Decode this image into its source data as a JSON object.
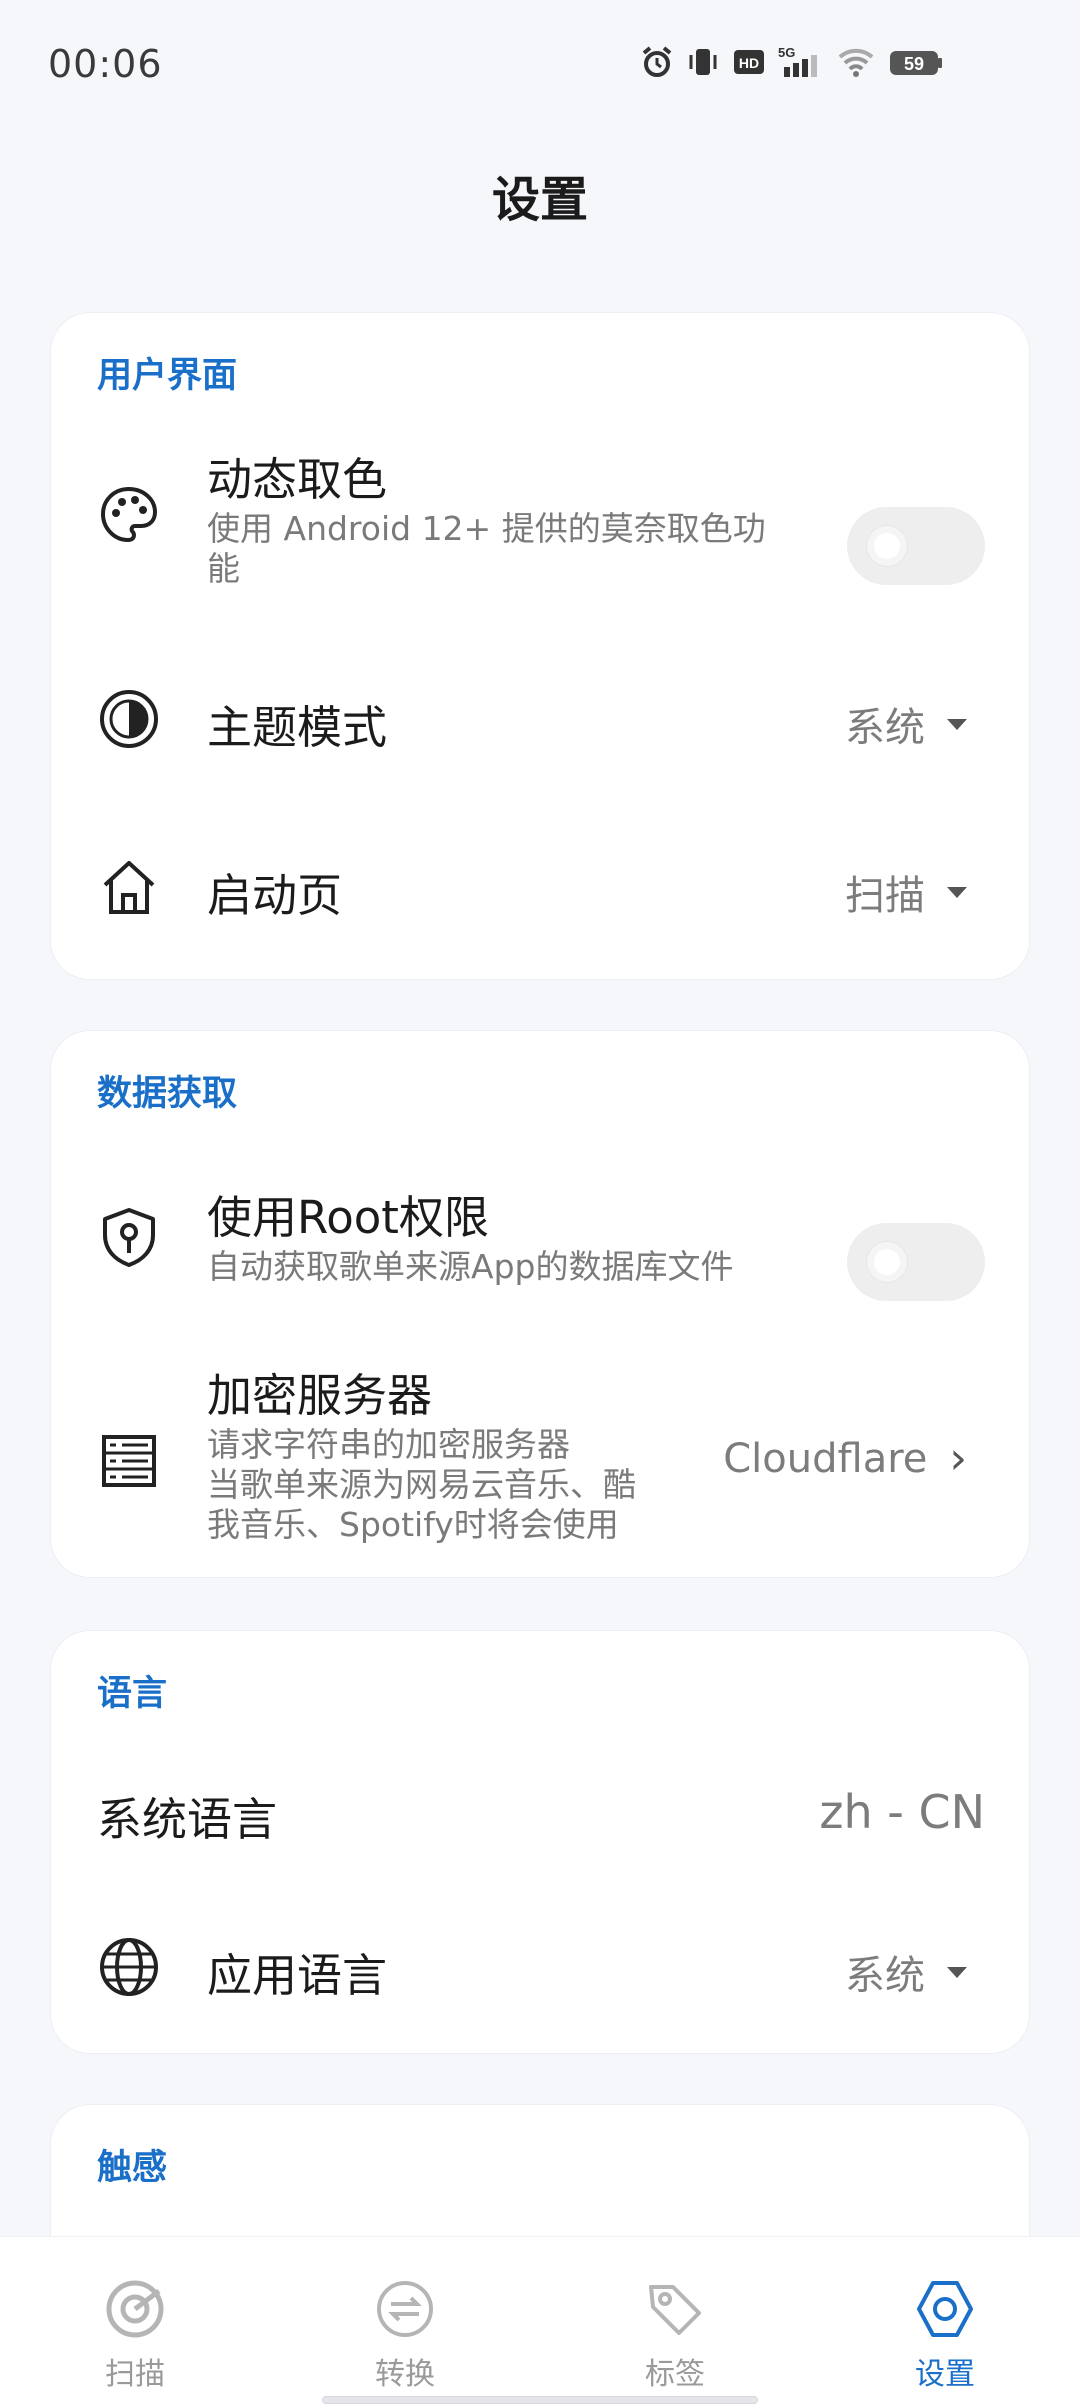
{
  "status_bar": {
    "time": "00:06",
    "network": "5G",
    "hd": "HD",
    "battery": "59",
    "icons": [
      "alarm-icon",
      "vibrate-icon",
      "hd-icon",
      "signal-icon",
      "wifi-icon",
      "battery-icon"
    ]
  },
  "header": {
    "title": "设置"
  },
  "sections": {
    "ui": {
      "title": "用户界面",
      "dynamic_color": {
        "title": "动态取色",
        "subtitle": "使用 Android 12+ 提供的莫奈取色功能",
        "enabled": false,
        "icon": "palette-icon"
      },
      "theme_mode": {
        "title": "主题模式",
        "value": "系统",
        "icon": "contrast-icon"
      },
      "start_page": {
        "title": "启动页",
        "value": "扫描",
        "icon": "home-icon"
      }
    },
    "data": {
      "title": "数据获取",
      "root": {
        "title": "使用Root权限",
        "subtitle": "自动获取歌单来源App的数据库文件",
        "enabled": false,
        "icon": "shield-key-icon"
      },
      "encrypt_server": {
        "title": "加密服务器",
        "subtitle_line1": "请求字符串的加密服务器",
        "subtitle_line2": "当歌单来源为网易云音乐、酷",
        "subtitle_line3": "我音乐、Spotify时将会使用",
        "value": "Cloudflare",
        "icon": "server-icon"
      }
    },
    "language": {
      "title": "语言",
      "system_language": {
        "title": "系统语言",
        "value": "zh - CN"
      },
      "app_language": {
        "title": "应用语言",
        "value": "系统",
        "icon": "globe-icon"
      }
    },
    "haptics": {
      "title": "触感"
    }
  },
  "bottom_nav": {
    "items": [
      {
        "label": "扫描",
        "icon": "scan-icon",
        "active": false
      },
      {
        "label": "转换",
        "icon": "convert-icon",
        "active": false
      },
      {
        "label": "标签",
        "icon": "tag-icon",
        "active": false
      },
      {
        "label": "设置",
        "icon": "settings-icon",
        "active": true
      }
    ]
  },
  "colors": {
    "accent": "#1a6fc8",
    "background": "#f5f7fa",
    "card": "#ffffff"
  }
}
